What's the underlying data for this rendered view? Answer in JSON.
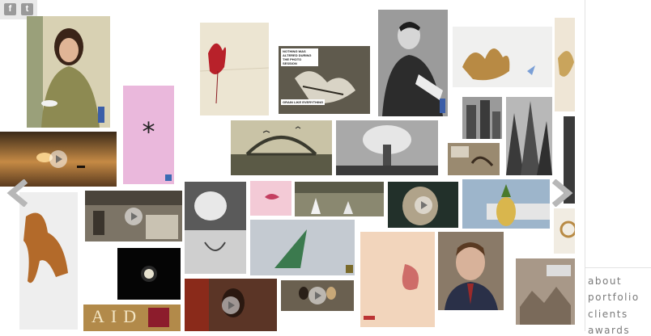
{
  "social": {
    "facebook_label": "f",
    "twitter_label": "t"
  },
  "nav": {
    "items": [
      "about",
      "portfolio",
      "clients",
      "awards"
    ]
  },
  "tiles": {
    "asterisk_glyph": "*",
    "aids_text": "AID",
    "poster_caption": "NOTHING WAS ALTERED DURING THE PHOTO SESSION",
    "poster_sub": "GRAIN LIKE EVERYTHING"
  },
  "colors": {
    "pink_tile": "#eab8dc",
    "sidebar_text": "#7a7a7a",
    "arrow": "#b7b7b7"
  }
}
